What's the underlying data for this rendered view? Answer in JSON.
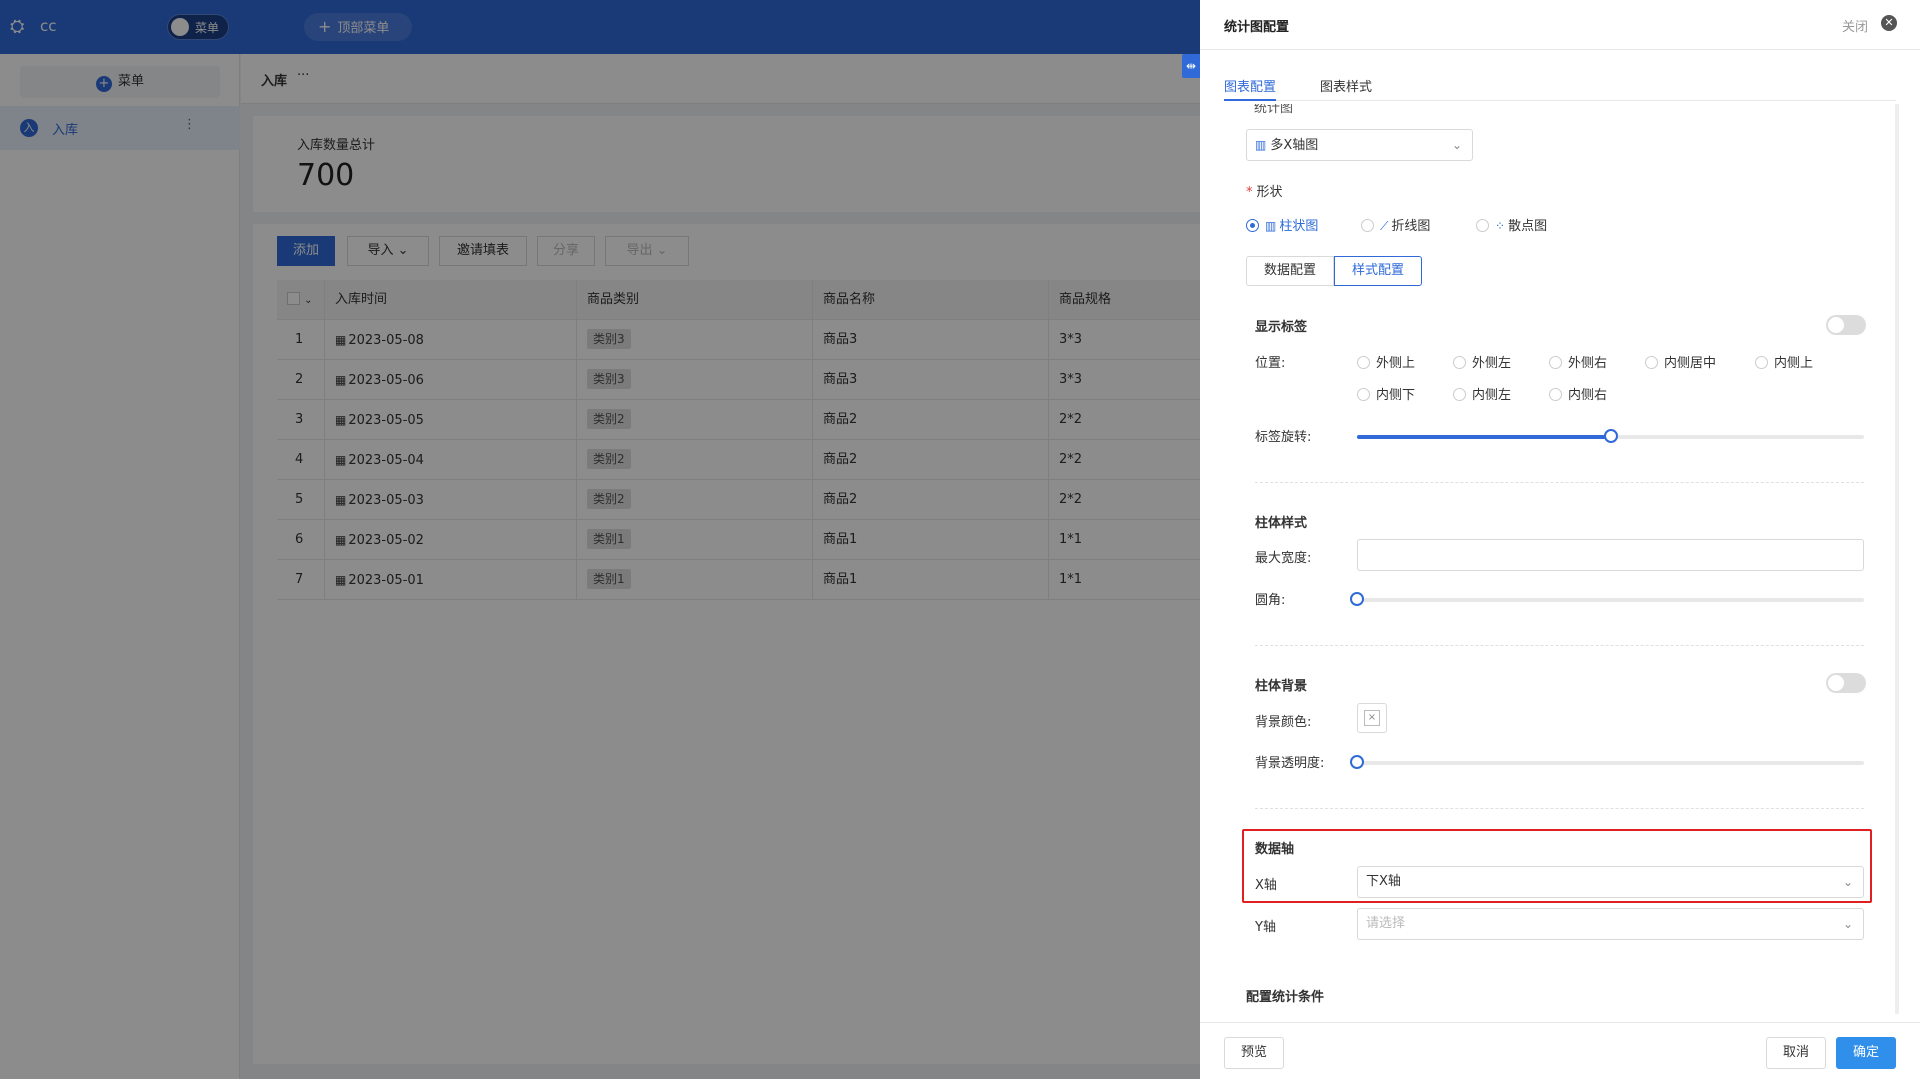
{
  "app": {
    "logo_text": "cc",
    "menu_toggle_label": "菜单",
    "top_menu_label": "顶部菜单",
    "sidebar": {
      "add_label": "菜单",
      "items": [
        {
          "avatar": "入",
          "label": "入库",
          "more": "⋮"
        }
      ]
    },
    "breadcrumb": {
      "title": "入库",
      "more": "···"
    },
    "stat": {
      "label": "入库数量总计",
      "value": "700"
    },
    "toolbar": {
      "add": "添加",
      "import": "导入",
      "invite": "邀请填表",
      "share": "分享",
      "export": "导出"
    },
    "table": {
      "headers": [
        "入库时间",
        "商品类别",
        "商品名称",
        "商品规格"
      ],
      "rows": [
        {
          "idx": "1",
          "date": "2023-05-08",
          "category": "类别3",
          "name": "商品3",
          "spec": "3*3"
        },
        {
          "idx": "2",
          "date": "2023-05-06",
          "category": "类别3",
          "name": "商品3",
          "spec": "3*3"
        },
        {
          "idx": "3",
          "date": "2023-05-05",
          "category": "类别2",
          "name": "商品2",
          "spec": "2*2"
        },
        {
          "idx": "4",
          "date": "2023-05-04",
          "category": "类别2",
          "name": "商品2",
          "spec": "2*2"
        },
        {
          "idx": "5",
          "date": "2023-05-03",
          "category": "类别2",
          "name": "商品2",
          "spec": "2*2"
        },
        {
          "idx": "6",
          "date": "2023-05-02",
          "category": "类别1",
          "name": "商品1",
          "spec": "1*1"
        },
        {
          "idx": "7",
          "date": "2023-05-01",
          "category": "类别1",
          "name": "商品1",
          "spec": "1*1"
        }
      ]
    }
  },
  "drawer": {
    "title": "统计图配置",
    "close_label": "关闭",
    "tabs": [
      {
        "label": "图表配置",
        "active": true
      },
      {
        "label": "图表样式",
        "active": false
      }
    ],
    "chart_label_partial": "统计图",
    "chart_type": {
      "value": "多X轴图",
      "icon": "bar-chart-icon"
    },
    "shape": {
      "label": "形状",
      "options": [
        {
          "label": "柱状图",
          "icon": "bar-chart-icon",
          "selected": true
        },
        {
          "label": "折线图",
          "icon": "line-chart-icon",
          "selected": false
        },
        {
          "label": "散点图",
          "icon": "scatter-chart-icon",
          "selected": false
        }
      ]
    },
    "config_tabs": [
      {
        "label": "数据配置",
        "active": false
      },
      {
        "label": "样式配置",
        "active": true
      }
    ],
    "show_label": {
      "title": "显示标签",
      "enabled": false,
      "position_label": "位置:",
      "positions": [
        "外侧上",
        "外侧左",
        "外侧右",
        "内侧居中",
        "内侧上",
        "内侧下",
        "内侧左",
        "内侧右"
      ],
      "rotation_label": "标签旋转:",
      "rotation_fraction": 0.5
    },
    "bar_style": {
      "title": "柱体样式",
      "max_width_label": "最大宽度:",
      "max_width_value": "",
      "radius_label": "圆角:",
      "radius_fraction": 0
    },
    "bar_background": {
      "title": "柱体背景",
      "enabled": false,
      "color_label": "背景颜色:",
      "color_placeholder": "×",
      "opacity_label": "背景透明度:",
      "opacity_fraction": 0
    },
    "axis": {
      "title": "数据轴",
      "x_label": "X轴",
      "x_value": "下X轴",
      "y_label": "Y轴",
      "y_placeholder": "请选择"
    },
    "condition_title": "配置统计条件",
    "footer": {
      "preview": "预览",
      "cancel": "取消",
      "confirm": "确定"
    }
  },
  "colors": {
    "primary": "#2f6ad8",
    "confirm": "#2f8fea",
    "highlight": "#e02020"
  }
}
